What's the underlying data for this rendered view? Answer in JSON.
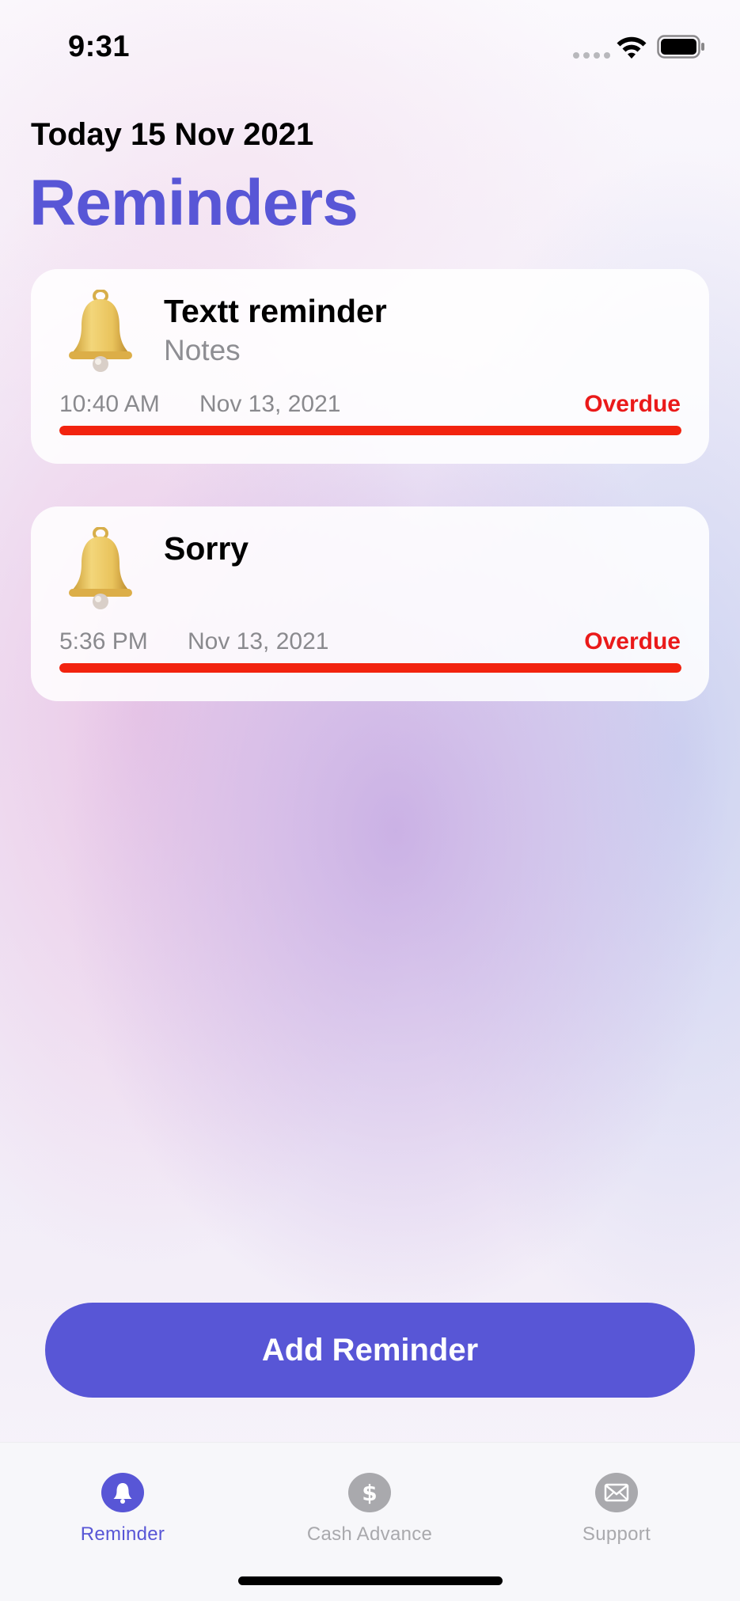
{
  "status_bar": {
    "time": "9:31"
  },
  "header": {
    "date": "Today 15 Nov 2021",
    "title": "Reminders"
  },
  "reminders": [
    {
      "icon": "bell-icon",
      "title": "Textt reminder",
      "notes": "Notes",
      "time": "10:40 AM",
      "date": "Nov 13, 2021",
      "status": "Overdue",
      "progress": 1.0
    },
    {
      "icon": "bell-icon",
      "title": "Sorry",
      "notes": "",
      "time": "5:36 PM",
      "date": "Nov 13, 2021",
      "status": "Overdue",
      "progress": 1.0
    }
  ],
  "add_button": {
    "label": "Add Reminder"
  },
  "tabs": [
    {
      "label": "Reminder",
      "icon": "bell-icon",
      "active": true
    },
    {
      "label": "Cash Advance",
      "icon": "dollar-icon",
      "active": false
    },
    {
      "label": "Support",
      "icon": "envelope-icon",
      "active": false
    }
  ],
  "colors": {
    "accent": "#5856d6",
    "overdue": "#ea1a1a",
    "progress_overdue": "#f2230f",
    "inactive": "#a9a9ad"
  }
}
